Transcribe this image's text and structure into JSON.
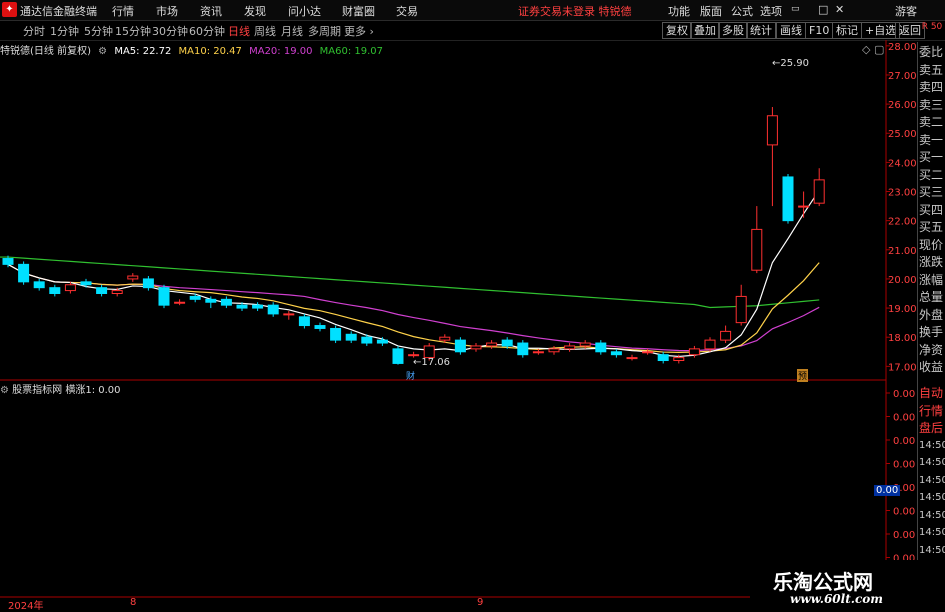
{
  "menubar": {
    "app_title": "通达信金融终端",
    "items": [
      "行情",
      "市场",
      "资讯",
      "发现",
      "问小达",
      "财富圈",
      "交易"
    ],
    "login_text": "证券交易未登录",
    "login_stock": "特锐德",
    "right_items": [
      "功能",
      "版面",
      "公式",
      "选项",
      "游客"
    ]
  },
  "periods": [
    "分时",
    "1分钟",
    "5分钟",
    "15分钟",
    "30分钟",
    "60分钟",
    "日线",
    "周线",
    "月线",
    "多周期",
    "更多"
  ],
  "active_period": "日线",
  "tools": [
    "复权",
    "叠加",
    "多股",
    "统计",
    "画线",
    "F10",
    "标记",
    "+自选",
    "返回"
  ],
  "chart": {
    "stock_label": "特锐德(日线 前复权)",
    "ma": [
      {
        "label": "MA5: 22.72",
        "color": "#ffffff"
      },
      {
        "label": "MA10: 20.47",
        "color": "#ffd24a"
      },
      {
        "label": "MA20: 19.00",
        "color": "#d040d0"
      },
      {
        "label": "MA60: 19.07",
        "color": "#30c030"
      }
    ],
    "high_label": "25.90",
    "low_label": "17.06",
    "cai_label": "财",
    "yu_label": "预",
    "price_axis": [
      "28.00",
      "27.00",
      "26.00",
      "25.00",
      "24.00",
      "23.00",
      "22.00",
      "21.00",
      "20.00",
      "19.00",
      "18.00",
      "17.00"
    ],
    "corner_label": "R 50"
  },
  "indicator": {
    "name": "股票指标网",
    "value_label": "横涨1: 0.00",
    "axis": [
      "0.00",
      "0.00",
      "0.00",
      "0.00",
      "0.00",
      "0.00",
      "0.00",
      "0.00"
    ],
    "current": "0.00"
  },
  "side_panel": {
    "items": [
      "委比",
      "卖五",
      "卖四",
      "卖三",
      "卖二",
      "卖一",
      "买一",
      "买二",
      "买三",
      "买四",
      "买五",
      "现价",
      "涨跌",
      "涨幅",
      "总量",
      "外盘",
      "换手",
      "净资",
      "收益"
    ],
    "items2": [
      "自动",
      "行情",
      "盘后",
      "14:50",
      "14:50",
      "14:50",
      "14:50",
      "14:50",
      "14:50",
      "14:50",
      "14:50",
      "14:50",
      "14:50"
    ]
  },
  "dates": {
    "d1": "2024年",
    "d2": "8",
    "d3": "9"
  },
  "watermark": {
    "name": "乐淘公式网",
    "url": "www.60lt.com"
  },
  "chart_data": {
    "type": "candlestick",
    "candles": [
      [
        20.7,
        20.5,
        20.8,
        20.4
      ],
      [
        20.5,
        19.9,
        20.6,
        19.8
      ],
      [
        19.9,
        19.7,
        20.0,
        19.6
      ],
      [
        19.7,
        19.5,
        19.8,
        19.4
      ],
      [
        19.6,
        19.8,
        19.9,
        19.5
      ],
      [
        19.9,
        19.8,
        20.0,
        19.7
      ],
      [
        19.7,
        19.5,
        19.8,
        19.4
      ],
      [
        19.5,
        19.6,
        19.7,
        19.4
      ],
      [
        20.0,
        20.1,
        20.2,
        19.9
      ],
      [
        20.0,
        19.7,
        20.1,
        19.6
      ],
      [
        19.7,
        19.1,
        19.8,
        19.0
      ],
      [
        19.2,
        19.2,
        19.3,
        19.1
      ],
      [
        19.4,
        19.3,
        19.5,
        19.2
      ],
      [
        19.3,
        19.2,
        19.4,
        19.0
      ],
      [
        19.3,
        19.1,
        19.4,
        19.0
      ],
      [
        19.1,
        19.0,
        19.2,
        18.9
      ],
      [
        19.1,
        19.0,
        19.2,
        18.9
      ],
      [
        19.1,
        18.8,
        19.2,
        18.7
      ],
      [
        18.8,
        18.8,
        18.9,
        18.6
      ],
      [
        18.7,
        18.4,
        18.8,
        18.3
      ],
      [
        18.4,
        18.3,
        18.5,
        18.2
      ],
      [
        18.3,
        17.9,
        18.4,
        17.8
      ],
      [
        18.1,
        17.9,
        18.2,
        17.8
      ],
      [
        18.0,
        17.8,
        18.1,
        17.7
      ],
      [
        17.9,
        17.8,
        18.0,
        17.7
      ],
      [
        17.6,
        17.1,
        17.7,
        17.06
      ],
      [
        17.4,
        17.4,
        17.5,
        17.3
      ],
      [
        17.3,
        17.7,
        17.8,
        17.2
      ],
      [
        17.9,
        18.0,
        18.1,
        17.8
      ],
      [
        17.9,
        17.5,
        18.0,
        17.4
      ],
      [
        17.6,
        17.7,
        17.8,
        17.5
      ],
      [
        17.7,
        17.8,
        17.9,
        17.6
      ],
      [
        17.9,
        17.7,
        18.0,
        17.6
      ],
      [
        17.8,
        17.4,
        17.9,
        17.3
      ],
      [
        17.5,
        17.5,
        17.6,
        17.4
      ],
      [
        17.5,
        17.6,
        17.7,
        17.4
      ],
      [
        17.6,
        17.7,
        17.8,
        17.5
      ],
      [
        17.7,
        17.8,
        17.9,
        17.6
      ],
      [
        17.8,
        17.5,
        17.9,
        17.4
      ],
      [
        17.5,
        17.4,
        17.6,
        17.3
      ],
      [
        17.3,
        17.3,
        17.4,
        17.2
      ],
      [
        17.5,
        17.5,
        17.6,
        17.4
      ],
      [
        17.4,
        17.2,
        17.5,
        17.1
      ],
      [
        17.2,
        17.3,
        17.4,
        17.1
      ],
      [
        17.4,
        17.6,
        17.7,
        17.3
      ],
      [
        17.6,
        17.9,
        18.0,
        17.5
      ],
      [
        17.9,
        18.2,
        18.4,
        17.8
      ],
      [
        18.5,
        19.4,
        19.8,
        18.4
      ],
      [
        20.3,
        21.7,
        22.5,
        20.2
      ],
      [
        24.6,
        25.6,
        25.9,
        22.5
      ],
      [
        23.5,
        22.0,
        23.6,
        21.9
      ],
      [
        22.5,
        22.5,
        23.0,
        22.1
      ],
      [
        22.6,
        23.4,
        23.8,
        22.5
      ]
    ],
    "ma_summary": {
      "MA5": 22.72,
      "MA10": 20.47,
      "MA20": 19.0,
      "MA60": 19.07
    },
    "ylim": [
      16.6,
      28.2
    ]
  }
}
